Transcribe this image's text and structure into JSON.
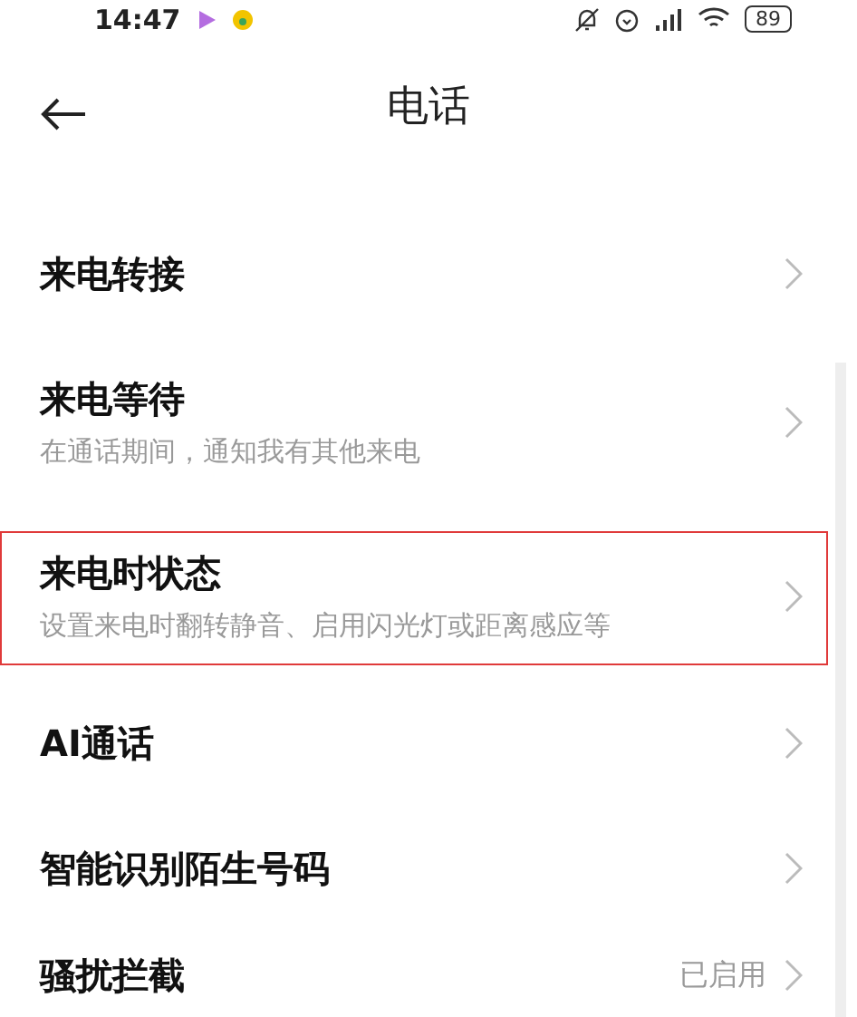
{
  "status_bar": {
    "time": "14:47",
    "battery": "89"
  },
  "header": {
    "title": "电话"
  },
  "items": [
    {
      "title": "来电转接",
      "highlighted": false
    },
    {
      "title": "来电等待",
      "subtitle": "在通话期间，通知我有其他来电",
      "highlighted": false
    },
    {
      "title": "来电时状态",
      "subtitle": "设置来电时翻转静音、启用闪光灯或距离感应等",
      "highlighted": true
    },
    {
      "title": "AI通话",
      "highlighted": false
    },
    {
      "title": "智能识别陌生号码",
      "highlighted": false
    },
    {
      "title": "骚扰拦截",
      "value": "已启用",
      "highlighted": false
    }
  ]
}
